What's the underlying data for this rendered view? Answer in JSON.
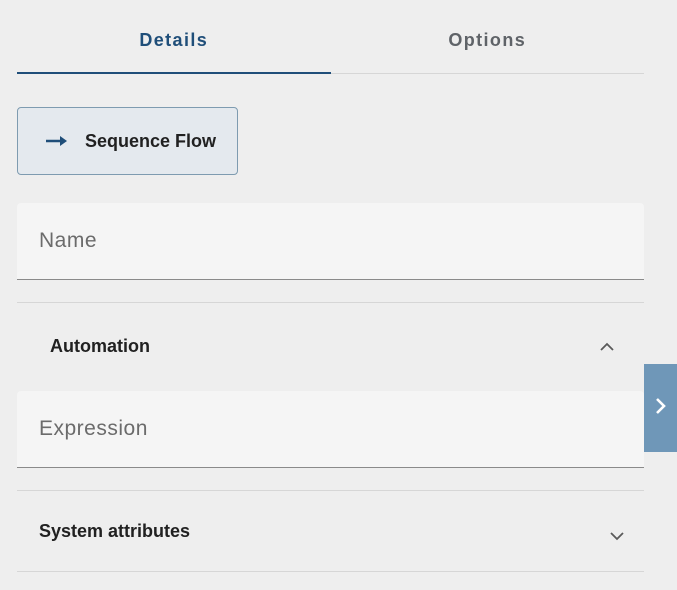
{
  "tabs": [
    {
      "label": "Details",
      "active": true
    },
    {
      "label": "Options",
      "active": false
    }
  ],
  "element_type": {
    "label": "Sequence Flow",
    "icon": "arrow-right-icon"
  },
  "name_field": {
    "value": "",
    "placeholder": "Name"
  },
  "automation": {
    "title": "Automation",
    "expanded": true,
    "toggle_icon": "chevron-up-icon",
    "expression_field": {
      "value": "",
      "placeholder": "Expression"
    }
  },
  "system_attributes": {
    "title": "System attributes",
    "expanded": false,
    "toggle_icon": "chevron-down-icon"
  },
  "side_toggle": {
    "icon": "chevron-right-icon"
  },
  "colors": {
    "accent": "#1f4e79",
    "chip_bg": "#e4e9ee",
    "chip_border": "#7e9bb0",
    "side_toggle_bg": "#6f97b8",
    "background": "#eeeeee",
    "field_bg": "#f5f5f5"
  }
}
